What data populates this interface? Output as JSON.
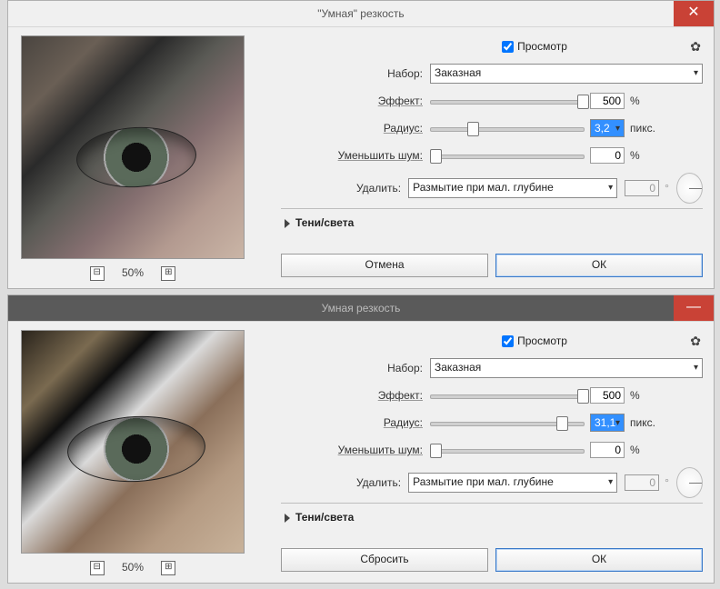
{
  "dialogs": [
    {
      "title": "\"Умная\" резкость",
      "closeGlyph": "✕",
      "preview": {
        "label": "Просмотр",
        "checked": true
      },
      "gearIcon": "✿",
      "preset": {
        "label": "Набор:",
        "value": "Заказная"
      },
      "amount": {
        "label": "Эффект:",
        "value": "500",
        "unit": "%",
        "pos": 95
      },
      "radius": {
        "label": "Радиус:",
        "value": "3,2",
        "unit": "пикс.",
        "pos": 24,
        "selected": true
      },
      "noise": {
        "label": "Уменьшить шум:",
        "value": "0",
        "unit": "%",
        "pos": 0
      },
      "remove": {
        "label": "Удалить:",
        "value": "Размытие при мал. глубине",
        "angle": "0",
        "angleUnit": "°"
      },
      "disclosure": "Тени/cвета",
      "buttons": {
        "cancel": "Отмена",
        "ok": "ОК"
      },
      "zoom": {
        "minus": "⊟",
        "value": "50%",
        "plus": "⊞"
      }
    },
    {
      "title": "Умная  резкость",
      "closeGlyph": "—",
      "preview": {
        "label": "Просмотр",
        "checked": true
      },
      "gearIcon": "✿",
      "preset": {
        "label": "Набор:",
        "value": "Заказная"
      },
      "amount": {
        "label": "Эффект:",
        "value": "500",
        "unit": "%",
        "pos": 95
      },
      "radius": {
        "label": "Радиус:",
        "value": "31,1",
        "unit": "пикс.",
        "pos": 82,
        "selected": true
      },
      "noise": {
        "label": "Уменьшить шум:",
        "value": "0",
        "unit": "%",
        "pos": 0
      },
      "remove": {
        "label": "Удалить:",
        "value": "Размытие при мал. глубине",
        "angle": "0",
        "angleUnit": "°"
      },
      "disclosure": "Тени/cвета",
      "buttons": {
        "cancel": "Сбросить",
        "ok": "ОК"
      },
      "zoom": {
        "minus": "⊟",
        "value": "50%",
        "plus": "⊞"
      }
    }
  ]
}
